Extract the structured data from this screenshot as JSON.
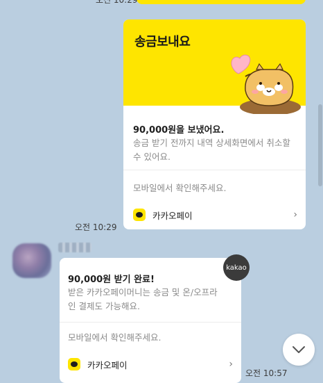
{
  "previous": {
    "time": "오전 10:29"
  },
  "sent_card": {
    "banner_title": "송금보내요",
    "amount_text": "90,000원을 보냈어요.",
    "description": "송금 받기 전까지 내역 상세화면에서 취소할 수 있어요.",
    "mobile_hint": "모바일에서 확인해주세요.",
    "brand": "카카오페이",
    "chevron": "›"
  },
  "sent_time": "오전 10:29",
  "sender": {
    "badge": "kakao"
  },
  "received_card": {
    "amount_text": "90,000원 받기 완료!",
    "description": "받은 카카오페이머니는 송금 및 온/오프라인 결제도 가능해요.",
    "mobile_hint": "모바일에서 확인해주세요.",
    "brand": "카카오페이",
    "chevron": "›"
  },
  "bottom_time": "오전 10:57",
  "colors": {
    "chat_bg": "#bacee0",
    "kakao_yellow": "#fee500",
    "card_bg": "#ffffff"
  },
  "icons": {
    "scroll_down": "chevron-down-icon",
    "pay": "kakaopay-icon",
    "mascot": "character-illustration"
  }
}
